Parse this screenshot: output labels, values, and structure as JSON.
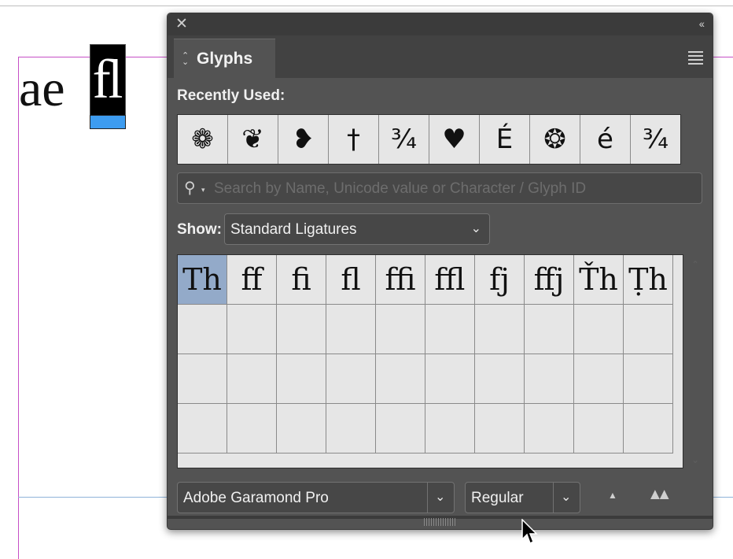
{
  "document": {
    "text": "ae",
    "selected_glyph": "ﬂ"
  },
  "panel": {
    "title": "Glyphs",
    "recently_used_label": "Recently Used:",
    "recent_glyphs": [
      "❁",
      "❦",
      "❥",
      "†",
      "¾",
      "♥",
      "É",
      "❂",
      "é",
      "¾"
    ],
    "search": {
      "placeholder": "Search by Name, Unicode value or Character / Glyph ID",
      "value": ""
    },
    "show_label": "Show:",
    "show_value": "Standard Ligatures",
    "glyph_grid": {
      "rows": [
        [
          "Th",
          "ﬀ",
          "ﬁ",
          "ﬂ",
          "ﬃ",
          "ﬄ",
          "fj",
          "ffj",
          "Ťh",
          "Ṭh"
        ],
        [
          "",
          "",
          "",
          "",
          "",
          "",
          "",
          "",
          "",
          ""
        ],
        [
          "",
          "",
          "",
          "",
          "",
          "",
          "",
          "",
          "",
          ""
        ],
        [
          "",
          "",
          "",
          "",
          "",
          "",
          "",
          "",
          "",
          ""
        ]
      ],
      "selected": "Th"
    },
    "font_family": "Adobe Garamond Pro",
    "font_style": "Regular"
  },
  "colors": {
    "panel_bg": "#535353",
    "selection": "#93aac9",
    "margin_guide": "#c64fc6",
    "selection_bar": "#3d9cf0"
  },
  "icons": [
    "close-icon",
    "collapse-icon",
    "menu-icon",
    "search-icon",
    "chevron-down-icon",
    "zoom-out-icon",
    "zoom-in-icon",
    "mouse-cursor-icon"
  ]
}
